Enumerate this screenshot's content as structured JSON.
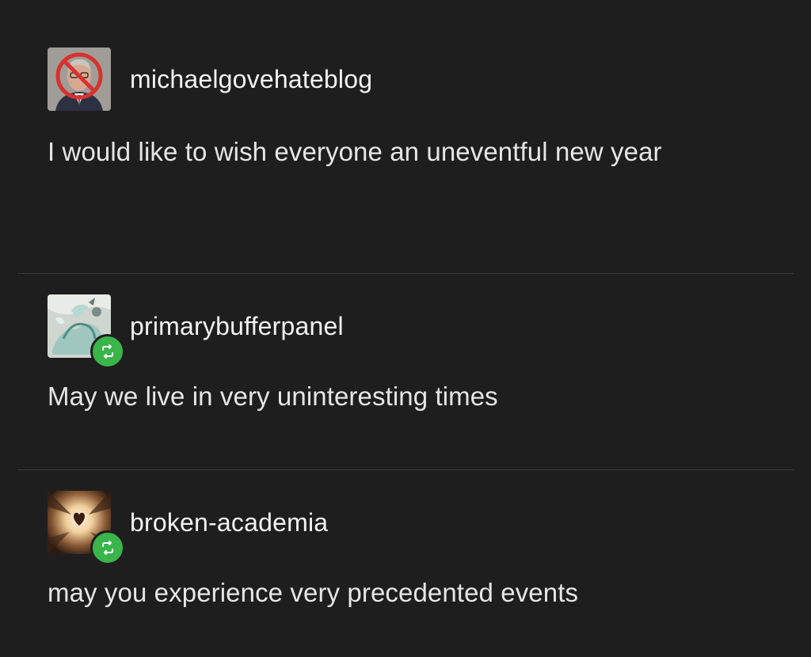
{
  "posts": [
    {
      "username": "michaelgovehateblog",
      "text": "I would like to wish everyone an uneventful new year",
      "avatar_icon": "crossed-out-portrait-icon",
      "reblogged": false
    },
    {
      "username": "primarybufferpanel",
      "text": "May we live in very uninteresting times",
      "avatar_icon": "pale-dragon-art-icon",
      "reblogged": true
    },
    {
      "username": "broken-academia",
      "text": "may you experience very precedented events",
      "avatar_icon": "heart-in-light-icon",
      "reblogged": true
    }
  ],
  "colors": {
    "background": "#1f1e1f",
    "text": "#e6e6e6",
    "reblog_badge": "#39b54a",
    "divider": "#3a393a"
  }
}
